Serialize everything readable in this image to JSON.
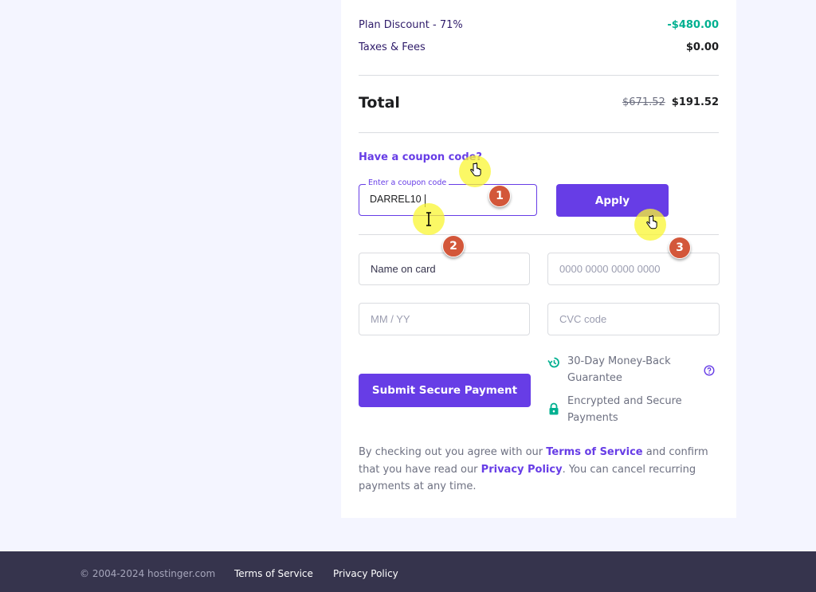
{
  "summary": {
    "discount_label": "Plan Discount - 71%",
    "discount_value": "-$480.00",
    "taxes_label": "Taxes & Fees",
    "taxes_value": "$0.00",
    "total_label": "Total",
    "total_old": "$671.52",
    "total_new": "$191.52"
  },
  "coupon": {
    "link_label": "Have a coupon code?",
    "field_label": "Enter a coupon code",
    "value": "DARREL10",
    "apply_label": "Apply"
  },
  "payment": {
    "name_placeholder": "Name on card",
    "card_placeholder": "0000 0000 0000 0000",
    "expiry_placeholder": "MM / YY",
    "cvc_placeholder": "CVC code",
    "submit_label": "Submit Secure Payment"
  },
  "guarantees": {
    "money_back": "30-Day Money-Back Guarantee",
    "secure": "Encrypted and Secure Payments"
  },
  "legal": {
    "part1": "By checking out you agree with our ",
    "terms_link": "Terms of Service",
    "part2": " and confirm that you have read our ",
    "privacy_link": "Privacy Policy",
    "part3": ". You can cancel recurring payments at any time."
  },
  "footer": {
    "copyright": "© 2004-2024 hostinger.com",
    "terms": "Terms of Service",
    "privacy": "Privacy Policy"
  },
  "annotations": {
    "step1": "1",
    "step2": "2",
    "step3": "3"
  },
  "colors": {
    "accent": "#673de6",
    "discount": "#00b090",
    "footer_bg": "#36344d",
    "badge": "#d3573a"
  }
}
